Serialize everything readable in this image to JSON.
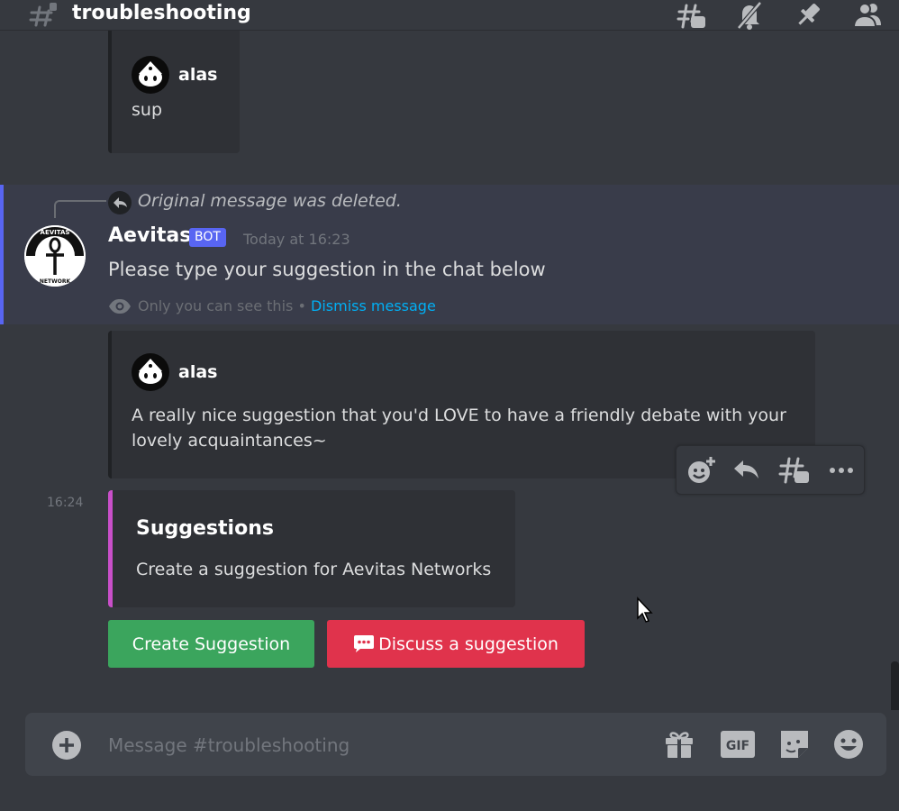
{
  "header": {
    "channel_name": "troubleshooting",
    "icons": [
      "threads-icon",
      "mute-bell-icon",
      "pin-icon",
      "members-icon"
    ]
  },
  "messages": {
    "quote_top": {
      "author": "alas",
      "text": "sup"
    },
    "reply_context": "Original message was deleted.",
    "bot_message": {
      "author": "Aevitas",
      "badge": "BOT",
      "timestamp": "Today at 16:23",
      "text": "Please type your suggestion in the chat below",
      "ephemeral_note": "Only you can see this",
      "separator": "•",
      "dismiss_label": "Dismiss message",
      "avatar_text_top": "AEVITAS",
      "avatar_text_bottom": "NETWORK"
    },
    "quote_bottom": {
      "author": "alas",
      "text": "A really nice suggestion that you'd LOVE to have a friendly debate with your lovely acquaintances~"
    },
    "followup": {
      "timestamp": "16:24",
      "embed_title": "Suggestions",
      "embed_description": "Create a suggestion for Aevitas Networks",
      "embed_color": "#c94fc9",
      "buttons": [
        {
          "label": "Create Suggestion",
          "color": "#3ba55d"
        },
        {
          "label": "Discuss a suggestion",
          "color": "#e0334c",
          "icon": "speech-bubble-icon"
        }
      ]
    }
  },
  "hover_toolbar": [
    "add-reaction-icon",
    "reply-icon",
    "create-thread-icon",
    "more-icon"
  ],
  "composer": {
    "placeholder": "Message #troubleshooting",
    "icons": [
      "add-attachment-icon",
      "gift-icon",
      "gif-icon",
      "sticker-icon",
      "emoji-icon"
    ],
    "gif_label": "GIF"
  },
  "colors": {
    "background": "#36393f",
    "accent": "#5865f2",
    "link": "#00aff4"
  }
}
